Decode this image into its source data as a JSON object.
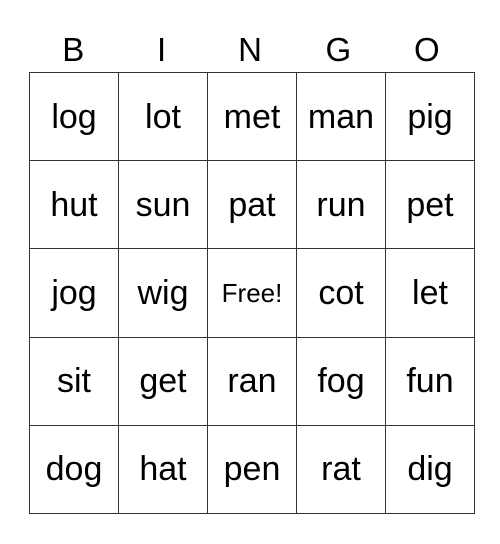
{
  "header": {
    "letters": [
      "B",
      "I",
      "N",
      "G",
      "O"
    ]
  },
  "board": {
    "rows": [
      [
        "log",
        "lot",
        "met",
        "man",
        "pig"
      ],
      [
        "hut",
        "sun",
        "pat",
        "run",
        "pet"
      ],
      [
        "jog",
        "wig",
        "Free!",
        "cot",
        "let"
      ],
      [
        "sit",
        "get",
        "ran",
        "fog",
        "fun"
      ],
      [
        "dog",
        "hat",
        "pen",
        "rat",
        "dig"
      ]
    ],
    "free_cell": {
      "row": 2,
      "col": 2
    }
  }
}
